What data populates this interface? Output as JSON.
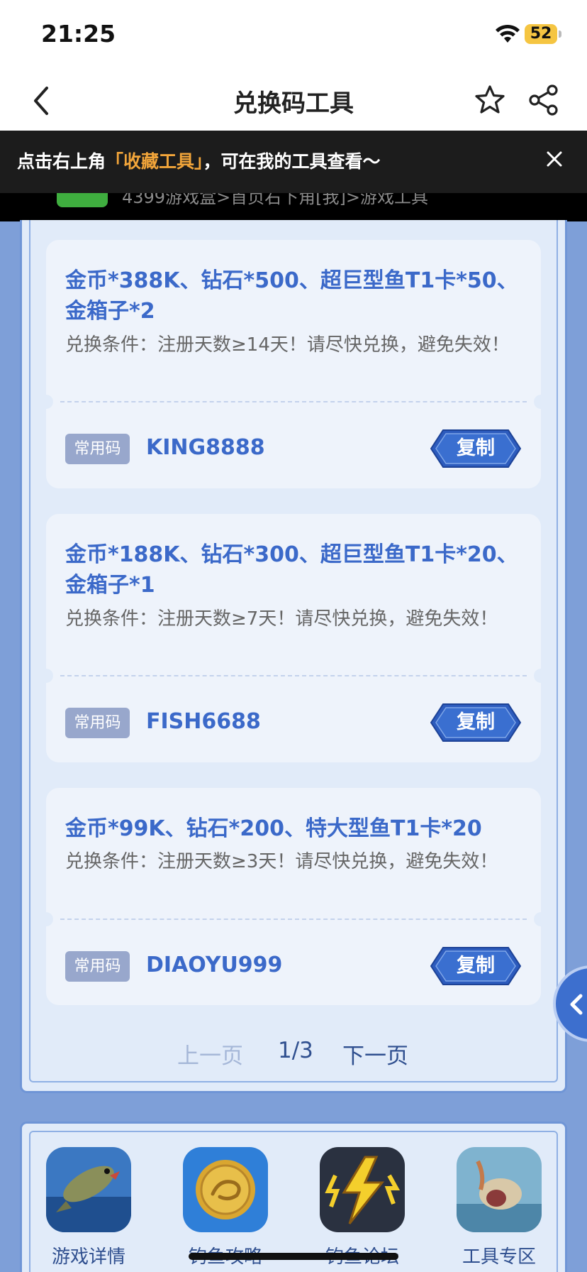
{
  "status_bar": {
    "time": "21:25",
    "battery": "52"
  },
  "nav": {
    "title": "兑换码工具"
  },
  "toast": {
    "prefix": "点击右上角",
    "highlight": "「收藏工具」",
    "suffix": "，可在我的工具查看～",
    "under_text": "4399游戏盒>首页右下角[我]>游戏工具"
  },
  "codes": [
    {
      "reward": "金币*388K、钻石*500、超巨型鱼T1卡*50、金箱子*2",
      "condition": "兑换条件：注册天数≥14天！请尽快兑换，避免失效！",
      "tag": "常用码",
      "code": "KING8888",
      "copy_label": "复制"
    },
    {
      "reward": "金币*188K、钻石*300、超巨型鱼T1卡*20、金箱子*1",
      "condition": "兑换条件：注册天数≥7天！请尽快兑换，避免失效！",
      "tag": "常用码",
      "code": "FISH6688",
      "copy_label": "复制"
    },
    {
      "reward": "金币*99K、钻石*200、特大型鱼T1卡*20",
      "condition": "兑换条件：注册天数≥3天！请尽快兑换，避免失效！",
      "tag": "常用码",
      "code": "DIAOYU999",
      "copy_label": "复制"
    }
  ],
  "pager": {
    "prev": "上一页",
    "current": "1/3",
    "next": "下一页"
  },
  "shortcuts": [
    {
      "label": "游戏详情",
      "icon": "fish-jumping-icon"
    },
    {
      "label": "钓鱼攻略",
      "icon": "gold-coin-icon"
    },
    {
      "label": "钓鱼论坛",
      "icon": "lightning-icon"
    },
    {
      "label": "工具专区",
      "icon": "fishing-catch-icon"
    }
  ],
  "colors": {
    "accent": "#3b69c9",
    "panel_bg": "#e1ebf9",
    "page_bg": "#7e9fd8",
    "toast_highlight": "#f2a53a"
  }
}
